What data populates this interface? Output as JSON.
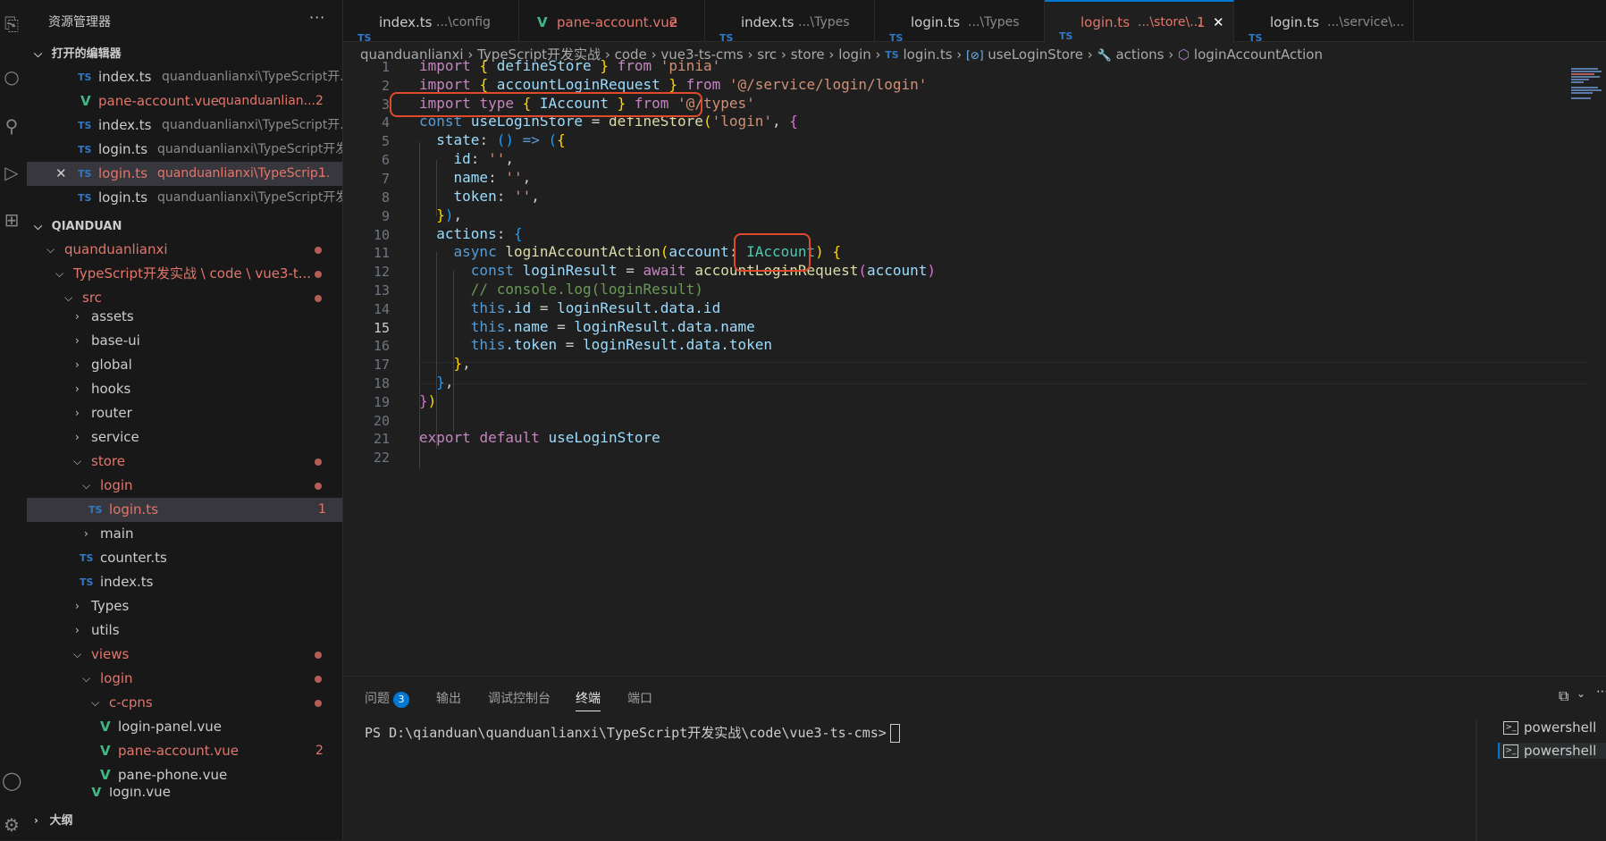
{
  "explorer": {
    "title": "资源管理器",
    "more": "···",
    "open_editors_title": "打开的编辑器",
    "open_editors": [
      {
        "icon": "TS",
        "name": "index.ts",
        "path": "quanduanlianxi\\TypeScript开...",
        "badge": ""
      },
      {
        "icon": "V",
        "name": "pane-account.vue",
        "path": "quanduanlian...",
        "badge": "2"
      },
      {
        "icon": "TS",
        "name": "index.ts",
        "path": "quanduanlianxi\\TypeScript开...",
        "badge": ""
      },
      {
        "icon": "TS",
        "name": "login.ts",
        "path": "quanduanlianxi\\TypeScript开发...",
        "badge": ""
      },
      {
        "icon": "TS",
        "name": "login.ts",
        "path": "quanduanlianxi\\TypeScrip...",
        "badge": "1",
        "close": "✕"
      },
      {
        "icon": "TS",
        "name": "login.ts",
        "path": "quanduanlianxi\\TypeScript开发...",
        "badge": ""
      }
    ],
    "workspace_title": "QIANDUAN",
    "tree": [
      {
        "name": "quanduanlianxi",
        "badge": ""
      },
      {
        "name": "TypeScript开发实战 \\ code \\ vue3-t...",
        "badge": ""
      },
      {
        "name": "src",
        "badge": ""
      },
      {
        "name": "assets",
        "badge": ""
      },
      {
        "name": "base-ui",
        "badge": ""
      },
      {
        "name": "global",
        "badge": ""
      },
      {
        "name": "hooks",
        "badge": ""
      },
      {
        "name": "router",
        "badge": ""
      },
      {
        "name": "service",
        "badge": ""
      },
      {
        "name": "store",
        "badge": ""
      },
      {
        "name": "login",
        "badge": ""
      },
      {
        "name": "login.ts",
        "badge": "1"
      },
      {
        "name": "main",
        "badge": ""
      },
      {
        "name": "counter.ts",
        "badge": ""
      },
      {
        "name": "index.ts",
        "badge": ""
      },
      {
        "name": "Types",
        "badge": ""
      },
      {
        "name": "utils",
        "badge": ""
      },
      {
        "name": "views",
        "badge": ""
      },
      {
        "name": "login",
        "badge": ""
      },
      {
        "name": "c-cpns",
        "badge": ""
      },
      {
        "name": "login-panel.vue",
        "badge": ""
      },
      {
        "name": "pane-account.vue",
        "badge": "2"
      },
      {
        "name": "pane-phone.vue",
        "badge": ""
      },
      {
        "name": "login.vue",
        "badge": ""
      }
    ],
    "outline_title": "大纲"
  },
  "tabs": [
    {
      "icon": "TS",
      "name": "index.ts",
      "desc": "...\\config",
      "badge": ""
    },
    {
      "icon": "V",
      "name": "pane-account.vue",
      "desc": "",
      "badge": "2"
    },
    {
      "icon": "TS",
      "name": "index.ts",
      "desc": "...\\Types",
      "badge": ""
    },
    {
      "icon": "TS",
      "name": "login.ts",
      "desc": "...\\Types",
      "badge": ""
    },
    {
      "icon": "TS",
      "name": "login.ts",
      "desc": "...\\store\\...",
      "badge": "1",
      "close": "✕"
    },
    {
      "icon": "TS",
      "name": "login.ts",
      "desc": "...\\service\\...",
      "badge": ""
    }
  ],
  "breadcrumbs": [
    "quanduanlianxi",
    "TypeScript开发实战",
    "code",
    "vue3-ts-cms",
    "src",
    "store",
    "login",
    "login.ts",
    "useLoginStore",
    "actions",
    "loginAccountAction"
  ],
  "breadcrumb_icons": {
    "ts": "TS",
    "symbol": "[⊘]",
    "wrench": "🔧",
    "cube": "⬡"
  },
  "editor": {
    "line_numbers": [
      "1",
      "2",
      "3",
      "4",
      "5",
      "6",
      "7",
      "8",
      "9",
      "10",
      "11",
      "12",
      "13",
      "14",
      "15",
      "16",
      "17",
      "18",
      "19",
      "20",
      "21",
      "22"
    ],
    "current_line": "15",
    "code": {
      "l1": [
        "import",
        "{",
        "defineStore",
        "}",
        "from",
        "'pinia'"
      ],
      "l2": [
        "import",
        "{",
        "accountLoginRequest",
        "}",
        "from",
        "'@/service/login/login'"
      ],
      "l3": [
        "import",
        "type",
        "{",
        "IAccount",
        "}",
        "from",
        "'@/types'"
      ],
      "l4": [
        "const",
        "useLoginStore",
        "=",
        "defineStore",
        "(",
        "'login'",
        ",",
        "{"
      ],
      "l5": [
        "state",
        ":",
        "()",
        "=>",
        "(",
        "{"
      ],
      "l6": [
        "id",
        ":",
        "''",
        ","
      ],
      "l7": [
        "name",
        ":",
        "''",
        ","
      ],
      "l8": [
        "token",
        ":",
        "''",
        ","
      ],
      "l9": [
        "}",
        ")",
        ","
      ],
      "l10": [
        "actions",
        ":",
        "{"
      ],
      "l11": [
        "async",
        "loginAccountAction",
        "(",
        "account",
        ":",
        "IAccount",
        ")",
        "{"
      ],
      "l12": [
        "const",
        "loginResult",
        "=",
        "await",
        "accountLoginRequest",
        "(",
        "account",
        ")"
      ],
      "l13": [
        "// console.log(loginResult)"
      ],
      "l14": [
        "this",
        ".id",
        "=",
        "loginResult",
        ".data",
        ".id"
      ],
      "l15": [
        "this",
        ".name",
        "=",
        "loginResult",
        ".data",
        ".name"
      ],
      "l16": [
        "this",
        ".token",
        "=",
        "loginResult",
        ".data",
        ".token"
      ],
      "l17": [
        "}",
        ","
      ],
      "l18": [
        "}",
        ","
      ],
      "l19": [
        "}",
        ")"
      ],
      "l21": [
        "export",
        "default",
        "useLoginStore"
      ]
    }
  },
  "panel": {
    "tabs": [
      "问题",
      "输出",
      "调试控制台",
      "终端",
      "端口"
    ],
    "problems_count": "3",
    "active_tab": "终端",
    "prompt": "PS D:\\qianduan\\quanduanlianxi\\TypeScript开发实战\\code\\vue3-ts-cms>",
    "terminals": [
      "powershell",
      "powershell"
    ],
    "split_icon": "⧉"
  },
  "colors": {
    "accent": "#0078d4",
    "modified": "#e2766b",
    "highlight_box": "#e04a2a",
    "ts": "#3178c6",
    "vue": "#41b883"
  }
}
